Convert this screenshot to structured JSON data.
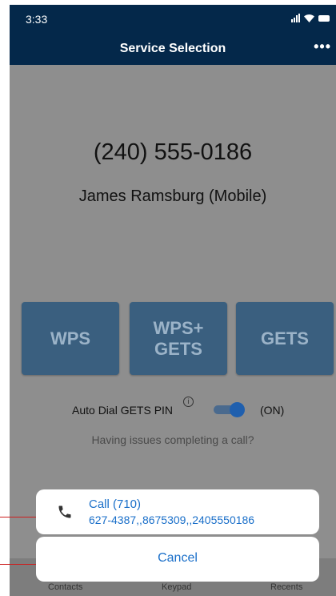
{
  "status_bar": {
    "time": "3:33",
    "icons": [
      "signal-icon",
      "wifi-icon",
      "battery-icon"
    ]
  },
  "nav": {
    "title": "Service Selection",
    "more_icon": "•••"
  },
  "call_info": {
    "number": "(240) 555-0186",
    "name": "James Ramsburg (Mobile)"
  },
  "services": [
    {
      "label": "WPS"
    },
    {
      "label": "WPS+\nGETS"
    },
    {
      "label": "GETS"
    }
  ],
  "auto_dial": {
    "label": "Auto Dial GETS PIN",
    "info_icon": "i",
    "state": "(ON)",
    "enabled": true
  },
  "issues_link": "Having issues completing a call?",
  "tab_bar": {
    "contacts": "Contacts",
    "keypad": "Keypad",
    "recents": "Recents"
  },
  "action_sheet": {
    "call_line1": "Call (710)",
    "call_line2": "627-4387,,8675309,,2405550186",
    "cancel": "Cancel"
  },
  "colors": {
    "nav_bg": "#04284a",
    "link_blue": "#1a6fc9",
    "service_button": "#3a5f7f",
    "toggle_on": "#1f5fae",
    "pointer": "#cc1f1f"
  }
}
